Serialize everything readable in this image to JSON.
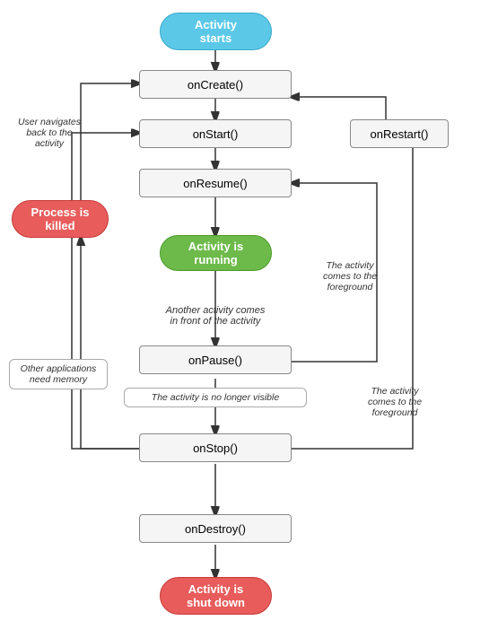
{
  "nodes": {
    "activity_starts": {
      "label": "Activity\nstarts"
    },
    "on_create": {
      "label": "onCreate()"
    },
    "on_start": {
      "label": "onStart()"
    },
    "on_resume": {
      "label": "onResume()"
    },
    "activity_running": {
      "label": "Activity is\nrunning"
    },
    "on_pause": {
      "label": "onPause()"
    },
    "on_stop": {
      "label": "onStop()"
    },
    "on_destroy": {
      "label": "onDestroy()"
    },
    "activity_shutdown": {
      "label": "Activity is\nshut down"
    },
    "on_restart": {
      "label": "onRestart()"
    },
    "process_killed": {
      "label": "Process is\nkilled"
    }
  },
  "labels": {
    "user_navigates": "User navigates\nback to the\nactivity",
    "another_activity": "Another activity comes\nin front of the activity",
    "activity_no_longer": "The activity is no longer visible",
    "other_apps_memory": "Other applications\nneed memory",
    "activity_foreground_1": "The activity\ncomes to the\nforeground",
    "activity_foreground_2": "The activity\ncomes to the\nforeground"
  }
}
